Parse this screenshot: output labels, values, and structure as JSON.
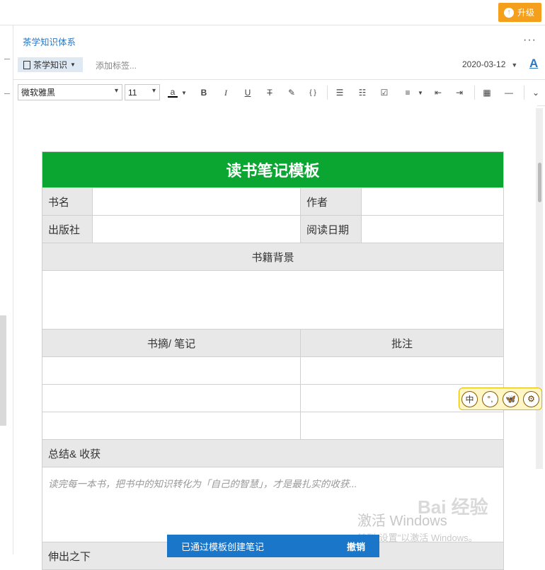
{
  "topbar": {
    "upgrade_label": "升级"
  },
  "note": {
    "notebook_name": "茶学知识体系",
    "more_label": "···",
    "tag_chip": "茶学知识",
    "add_tag_placeholder": "添加标签...",
    "date": "2020-03-12",
    "format_label": "A"
  },
  "toolbar": {
    "font_family": "微软雅黑",
    "font_size": "11"
  },
  "template": {
    "title": "读书笔记模板",
    "book_name": "书名",
    "author": "作者",
    "publisher": "出版社",
    "read_date": "阅读日期",
    "background": "书籍背景",
    "excerpt": "书摘/ 笔记",
    "comment": "批注",
    "summary": "总结& 收获",
    "summary_hint": "读完每一本书，把书中的知识转化为「自己的智慧」，才是最扎实的收获...",
    "last_row": "伸出之下"
  },
  "toast": {
    "message": "已通过模板创建笔记",
    "undo": "撤销"
  },
  "watermark": {
    "line1": "激活 Windows",
    "line2": "转到\"设置\"以激活 Windows。",
    "logo": "Bai 经验"
  },
  "ime": {
    "items": [
      "中",
      "°,",
      "🦋",
      "⚙"
    ]
  }
}
